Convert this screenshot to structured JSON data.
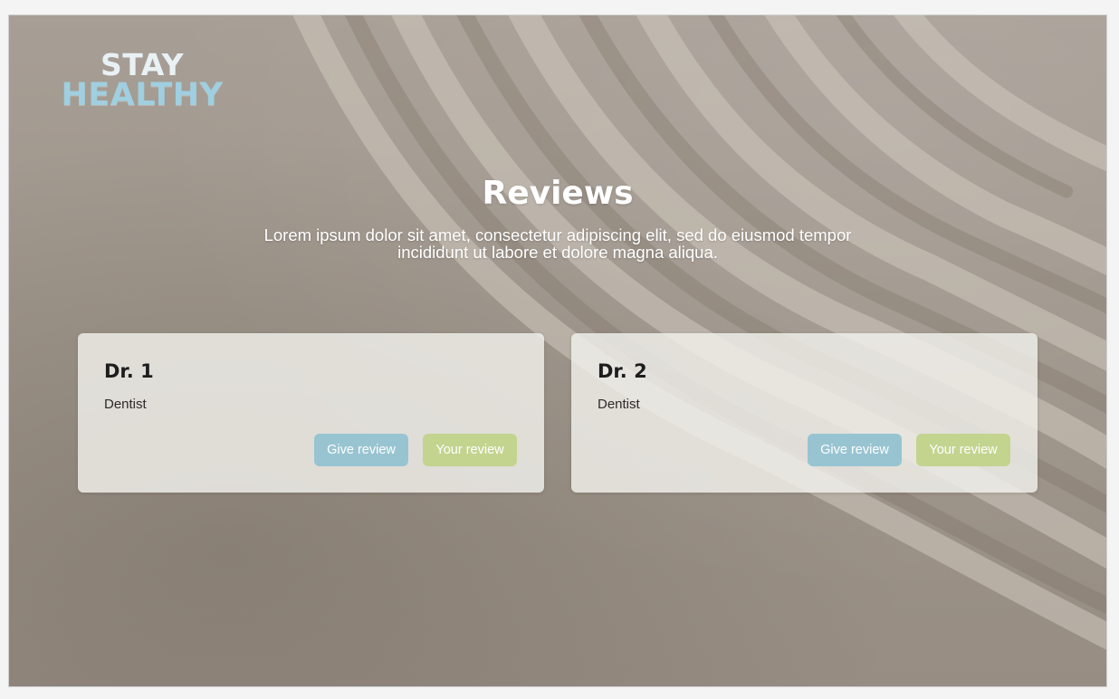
{
  "brand": {
    "line1": "STAY",
    "line2": "HEALTHY",
    "colors": {
      "line1": "#e8f1f4",
      "line2": "#9fcfe0"
    }
  },
  "page": {
    "title": "Reviews",
    "subtitle": "Lorem ipsum dolor sit amet, consectetur adipiscing elit, sed do eiusmod tempor incididunt ut labore et dolore magna aliqua."
  },
  "doctors": [
    {
      "name": "Dr. 1",
      "specialty": "Dentist",
      "give_review_label": "Give review",
      "your_review_label": "Your review"
    },
    {
      "name": "Dr. 2",
      "specialty": "Dentist",
      "give_review_label": "Give review",
      "your_review_label": "Your review"
    }
  ],
  "colors": {
    "give_review_button": "#98c4d2",
    "your_review_button": "#c3d48f",
    "card_background": "#f2f0ec"
  },
  "icons": []
}
